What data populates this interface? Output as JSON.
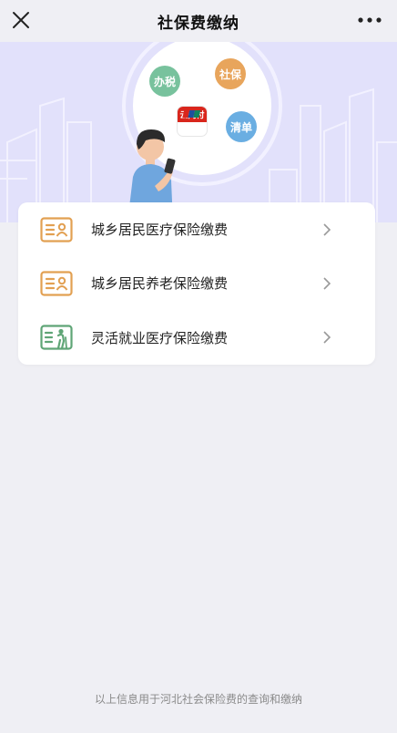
{
  "nav": {
    "title": "社保费缴纳",
    "close_icon": "close-icon",
    "more_icon": "more-dots-icon"
  },
  "banner": {
    "bubbles": [
      "办税",
      "社保",
      "清单"
    ],
    "app_logo_text": "云闪付",
    "colors": {
      "background": "#e2e1fb",
      "bubble_green": "#78c29d",
      "bubble_orange": "#e8a55c",
      "bubble_blue": "#6aaee2"
    }
  },
  "menu": {
    "items": [
      {
        "label": "城乡居民医疗保险缴费",
        "icon": "id-card-icon",
        "color": "#e2a052"
      },
      {
        "label": "城乡居民养老保险缴费",
        "icon": "id-card-icon",
        "color": "#e2a052"
      },
      {
        "label": "灵活就业医疗保险缴费",
        "icon": "elderly-card-icon",
        "color": "#5fa576"
      }
    ]
  },
  "footer": {
    "text": "以上信息用于河北社会保险费的查询和缴纳"
  }
}
